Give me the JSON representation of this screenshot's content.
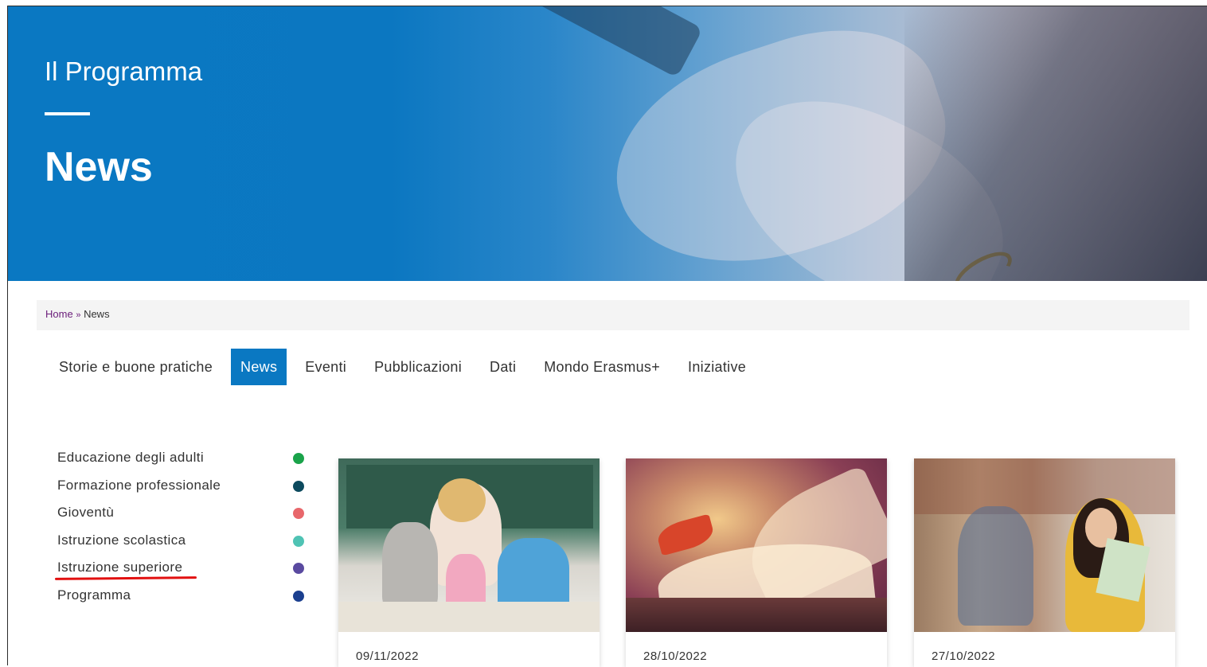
{
  "hero": {
    "kicker": "Il Programma",
    "title": "News"
  },
  "breadcrumb": {
    "home": "Home",
    "separator": "»",
    "current": "News"
  },
  "tabs": [
    {
      "label": "Storie e buone pratiche",
      "active": false
    },
    {
      "label": "News",
      "active": true
    },
    {
      "label": "Eventi",
      "active": false
    },
    {
      "label": "Pubblicazioni",
      "active": false
    },
    {
      "label": "Dati",
      "active": false
    },
    {
      "label": "Mondo Erasmus+",
      "active": false
    },
    {
      "label": "Iniziative",
      "active": false
    }
  ],
  "categories": [
    {
      "label": "Educazione degli adulti",
      "color": "#1aa34a"
    },
    {
      "label": "Formazione professionale",
      "color": "#0c4a5e"
    },
    {
      "label": "Gioventù",
      "color": "#e8676b"
    },
    {
      "label": "Istruzione scolastica",
      "color": "#4fc3b4"
    },
    {
      "label": "Istruzione superiore",
      "color": "#5a4aa0",
      "highlighted": true
    },
    {
      "label": "Programma",
      "color": "#1b3f8f"
    }
  ],
  "cards": [
    {
      "date": "09/11/2022"
    },
    {
      "date": "28/10/2022"
    },
    {
      "date": "27/10/2022"
    }
  ],
  "colors": {
    "brand_blue": "#0a78c2",
    "highlight_underline": "#e21010",
    "breadcrumb_link": "#6a1d7a"
  }
}
